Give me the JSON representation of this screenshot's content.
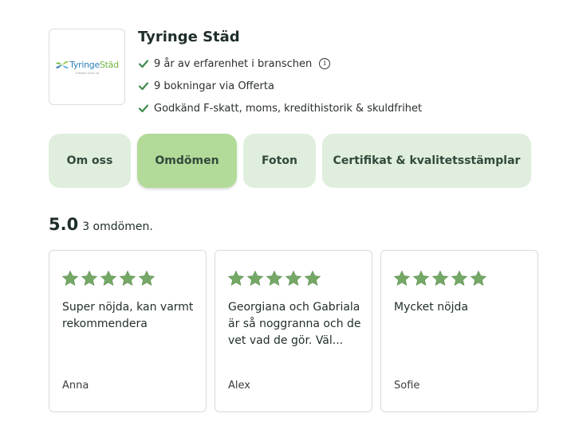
{
  "company": {
    "name": "Tyringe Städ",
    "logo_text_a": "Tyringe",
    "logo_text_b": "Städ",
    "logo_subtext": "TYRINGE STÄD AB"
  },
  "facts": [
    {
      "text": "9 år av erfarenhet i branschen",
      "has_info": true
    },
    {
      "text": "9 bokningar via Offerta",
      "has_info": false
    },
    {
      "text": "Godkänd F-skatt, moms, kredithistorik & skuldfrihet",
      "has_info": false
    }
  ],
  "info_glyph": "i",
  "tabs": [
    {
      "label": "Om oss",
      "active": false
    },
    {
      "label": "Omdömen",
      "active": true
    },
    {
      "label": "Foton",
      "active": false
    },
    {
      "label": "Certifikat & kvalitetsstämplar",
      "active": false
    }
  ],
  "rating": {
    "score": "5.0",
    "count_text": "3 omdömen."
  },
  "reviews": [
    {
      "stars": 5,
      "text": "Super nöjda, kan varmt rekommendera",
      "author": "Anna"
    },
    {
      "stars": 5,
      "text": "Georgiana och Gabriala är så noggranna och de vet vad de gör. Väl...",
      "author": "Alex"
    },
    {
      "stars": 5,
      "text": "Mycket nöjda",
      "author": "Sofie"
    }
  ],
  "colors": {
    "tab_bg": "#dfeedd",
    "tab_active_bg": "#b2db99",
    "star": "#75a867",
    "check": "#3f8b4d"
  }
}
